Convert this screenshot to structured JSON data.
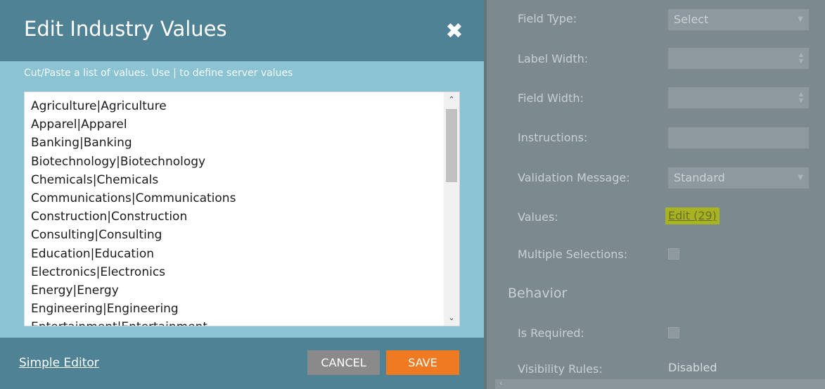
{
  "dialog": {
    "title": "Edit Industry Values",
    "close_icon": "close-icon",
    "instructions": "Cut/Paste a list of values. Use | to define server values",
    "values": [
      "Agriculture|Agriculture",
      "Apparel|Apparel",
      "Banking|Banking",
      "Biotechnology|Biotechnology",
      "Chemicals|Chemicals",
      "Communications|Communications",
      "Construction|Construction",
      "Consulting|Consulting",
      "Education|Education",
      "Electronics|Electronics",
      "Energy|Energy",
      "Engineering|Engineering",
      "Entertainment|Entertainment"
    ],
    "simple_editor_label": "Simple Editor",
    "cancel_label": "CANCEL",
    "save_label": "SAVE",
    "colors": {
      "header": "#4f8294",
      "body": "#8bc3d3",
      "save": "#f07a22",
      "cancel": "#8a8a8a"
    }
  },
  "properties": {
    "field_type_label": "Field Type:",
    "field_type_value": "Select",
    "label_width_label": "Label Width:",
    "field_width_label": "Field Width:",
    "instructions_label": "Instructions:",
    "validation_message_label": "Validation Message:",
    "validation_message_value": "Standard",
    "values_label": "Values:",
    "values_edit_link": "Edit (29)",
    "multiple_selections_label": "Multiple Selections:",
    "behavior_heading": "Behavior",
    "is_required_label": "Is Required:",
    "visibility_rules_label": "Visibility Rules:",
    "visibility_rules_value": "Disabled"
  }
}
